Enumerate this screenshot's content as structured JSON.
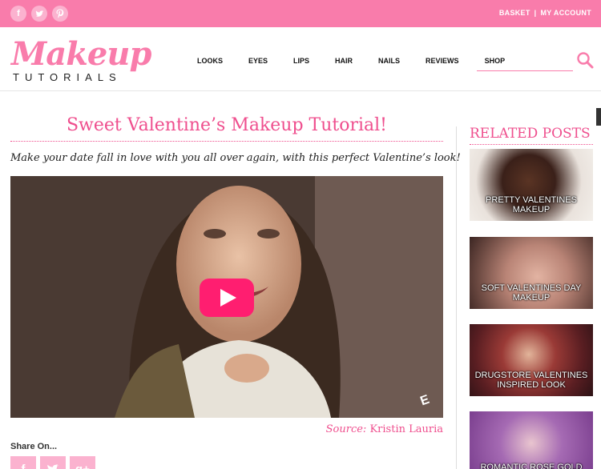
{
  "top_bar": {
    "social_icons": [
      "facebook-icon",
      "twitter-icon",
      "pinterest-icon"
    ],
    "basket": "BASKET",
    "separator": "|",
    "account": "MY ACCOUNT"
  },
  "logo": {
    "main": "Makeup",
    "sub": "TUTORIALS"
  },
  "nav": [
    "LOOKS",
    "EYES",
    "LIPS",
    "HAIR",
    "NAILS",
    "REVIEWS",
    "SHOP"
  ],
  "search": {
    "placeholder": ""
  },
  "article": {
    "title": "Sweet Valentine’s Makeup Tutorial!",
    "intro": "Make your date fall in love with you all over again, with this perfect Valentine’s look!",
    "source_label": "Source:",
    "source_name": "Kristin Lauria"
  },
  "share": {
    "heading": "Share On...",
    "icons": {
      "facebook": "f",
      "twitter": "t",
      "google_plus": "g+"
    }
  },
  "related": {
    "heading": "RELATED POSTS",
    "items": [
      {
        "label": "PRETTY VALENTINES MAKEUP"
      },
      {
        "label": "SOFT VALENTINES DAY MAKEUP"
      },
      {
        "label": "DRUGSTORE VALENTINES INSPIRED LOOK"
      },
      {
        "label": "ROMANTIC ROSE GOLD"
      }
    ]
  },
  "colors": {
    "brand_pink": "#f97cab",
    "title_pink": "#ef4f8e",
    "play_button": "#ff1e70"
  }
}
